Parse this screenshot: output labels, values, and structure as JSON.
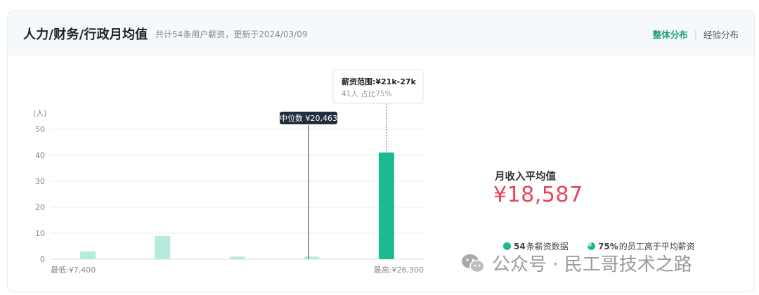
{
  "header": {
    "title": "人力/财务/行政月均值",
    "subtitle": "共计54条用户薪资，更新于2024/03/09",
    "tabs": [
      {
        "label": "整体分布",
        "active": true
      },
      {
        "label": "经验分布",
        "active": false
      }
    ]
  },
  "chart_data": {
    "type": "bar",
    "categories": [
      "1",
      "2",
      "3",
      "4",
      "5"
    ],
    "values": [
      3,
      9,
      1,
      1,
      41
    ],
    "highlight_index": 4,
    "ylabel": "(人)",
    "ylim": [
      0,
      50
    ],
    "yticks": [
      0,
      10,
      20,
      30,
      40,
      50
    ],
    "x_min_label": "最低:¥7,400",
    "x_max_label": "最高:¥26,300",
    "x_range": [
      7400,
      26300
    ],
    "median": {
      "label": "中位数 ¥20,463",
      "value": 20463
    },
    "tooltip": {
      "title": "薪资范围:¥21k-27k",
      "detail": "41人  占比75%"
    },
    "colors": {
      "bar": "#b5ecdd",
      "highlight": "#1db993",
      "median_line": "#2c3a4a",
      "grid": "#eeeeee"
    },
    "grid": true
  },
  "stats": {
    "avg_label": "月收入平均值",
    "avg_value": "¥18,587",
    "count_bold": "54",
    "count_text": "条薪资数据",
    "pct_bold": "75%",
    "pct_text": "的员工高于平均薪资"
  },
  "watermark": {
    "text": "公众号 · 民工哥技术之路"
  }
}
